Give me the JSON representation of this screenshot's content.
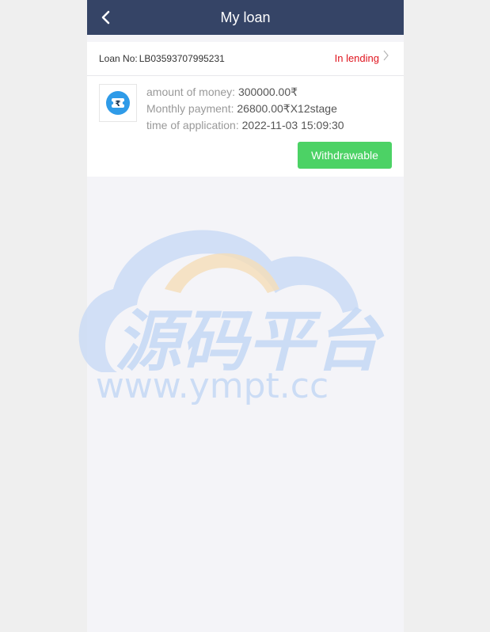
{
  "header": {
    "title": "My loan",
    "back_icon": "chevron-left-icon",
    "bg_color": "#354466"
  },
  "loan": {
    "loan_no_label": "Loan No:",
    "loan_no_value": "LB03593707995231",
    "status": "In lending",
    "status_color": "#e0151f",
    "amount_label": "amount of money:",
    "amount_value": "300000.00₹",
    "monthly_label": "Monthly payment:",
    "monthly_value": "26800.00₹X12stage",
    "application_label": "time of application:",
    "application_value": "2022-11-03 15:09:30",
    "action_button": "Withdrawable",
    "action_color": "#4cd265",
    "icon": "rupee-ticket-icon"
  },
  "watermark": {
    "text": "源码平台",
    "url": "www.ympt.cc"
  }
}
